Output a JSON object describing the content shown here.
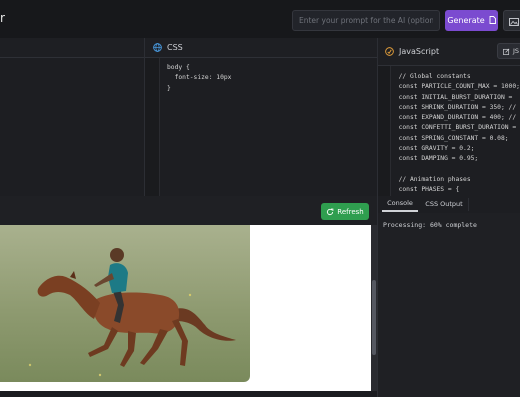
{
  "app": {
    "title": "r"
  },
  "topbar": {
    "prompt_placeholder": "Enter your prompt for the AI (optional)",
    "generate_label": "Generate"
  },
  "css_panel": {
    "title": "CSS",
    "code": "body {\n  font-size: 10px\n}"
  },
  "js_panel": {
    "title": "JavaScript",
    "button_label": "JS",
    "code": "  // Global constants\n  const PARTICLE_COUNT_MAX = 1000;\n  const INITIAL_BURST_DURATION = \n  const SHRINK_DURATION = 350; //\n  const EXPAND_DURATION = 400; //\n  const CONFETTI_BURST_DURATION =\n  const SPRING_CONSTANT = 0.08;\n  const GRAVITY = 0.2;\n  const DAMPING = 0.95;\n\n  // Animation phases\n  const PHASES = {"
  },
  "preview": {
    "refresh_label": "Refresh",
    "image_alt": "Boy riding a galloping brown horse on a grassy field"
  },
  "console_panel": {
    "tabs": [
      {
        "label": "Console",
        "active": true
      },
      {
        "label": "CSS Output",
        "active": false
      }
    ],
    "output": "Processing: 60% complete"
  },
  "colors": {
    "accent_purple": "#7b4bd0",
    "refresh_green": "#2f9e4f",
    "background": "#1b1c20"
  }
}
